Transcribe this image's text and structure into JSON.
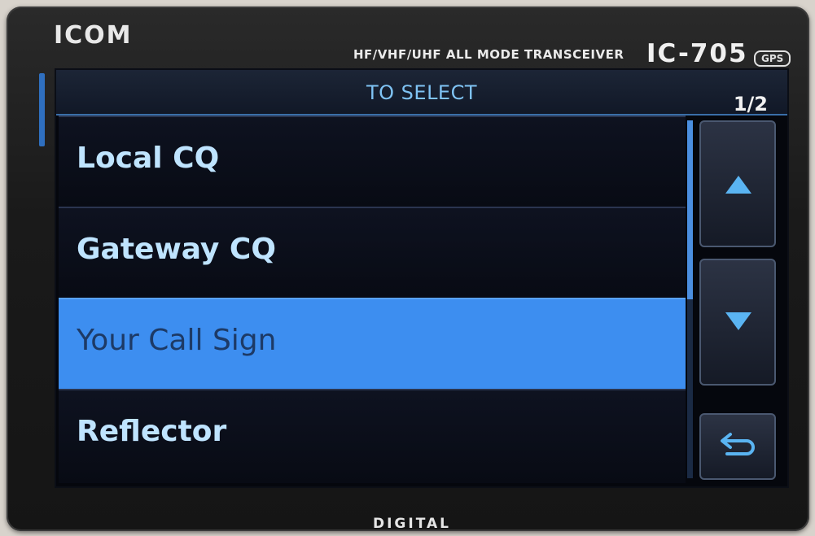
{
  "device": {
    "brand": "ICOM",
    "description": "HF/VHF/UHF ALL MODE TRANSCEIVER",
    "model": "IC-705",
    "badge": "GPS",
    "footer": "DIGITAL"
  },
  "screen": {
    "title": "TO SELECT",
    "page": "1/2",
    "items": [
      {
        "label": "Local CQ",
        "selected": false
      },
      {
        "label": "Gateway CQ",
        "selected": false
      },
      {
        "label": "Your Call Sign",
        "selected": true
      },
      {
        "label": "Reflector",
        "selected": false
      }
    ],
    "buttons": {
      "up": "triangle-up-icon",
      "down": "triangle-down-icon",
      "back": "return-arrow-icon"
    }
  },
  "colors": {
    "selected": "#3d8ef0",
    "text": "#bfe4ff",
    "accent": "#5ab4f2"
  }
}
